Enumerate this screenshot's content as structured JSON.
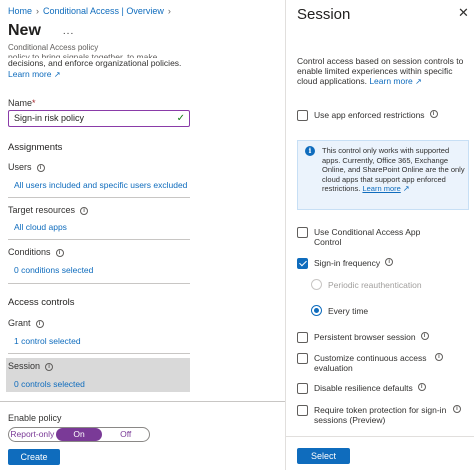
{
  "breadcrumb": {
    "items": [
      "Home",
      "Conditional Access | Overview"
    ]
  },
  "page": {
    "title": "New",
    "more": "...",
    "subtitle": "Conditional Access policy",
    "desc_clipped": "policy to bring signals together, to make",
    "desc_lines": [
      "decisions, and enforce organizational policies."
    ],
    "learn_more": "Learn more"
  },
  "name_field": {
    "label": "Name",
    "required_mark": "*",
    "value": "Sign-in risk policy"
  },
  "assignments": {
    "heading": "Assignments",
    "users": {
      "label": "Users",
      "value": "All users included and specific users excluded"
    },
    "targets": {
      "label": "Target resources",
      "value": "All cloud apps"
    },
    "conditions": {
      "label": "Conditions",
      "value": "0 conditions selected"
    }
  },
  "access_controls": {
    "heading": "Access controls",
    "grant": {
      "label": "Grant",
      "value": "1 control selected"
    },
    "session": {
      "label": "Session",
      "value": "0 controls selected"
    }
  },
  "enable_policy": {
    "label": "Enable policy",
    "options": [
      "Report-only",
      "On",
      "Off"
    ],
    "selected": "On"
  },
  "create_button": "Create",
  "panel": {
    "title": "Session",
    "description": "Control access based on session controls to enable limited experiences within specific cloud applications.",
    "learn_more": "Learn more",
    "app_enforced": {
      "label": "Use app enforced restrictions",
      "checked": false
    },
    "info_text": "This control only works with supported apps. Currently, Office 365, Exchange Online, and SharePoint Online are the only cloud apps that support app enforced restrictions.",
    "info_learn_more": "Learn more",
    "app_control": {
      "label": "Use Conditional Access App Control",
      "checked": false
    },
    "signin_freq": {
      "label": "Sign-in frequency",
      "checked": true
    },
    "periodic": {
      "label": "Periodic reauthentication",
      "selected": false
    },
    "every_time": {
      "label": "Every time",
      "selected": true
    },
    "persistent": {
      "label": "Persistent browser session",
      "checked": false
    },
    "cae": {
      "label": "Customize continuous access evaluation",
      "checked": false
    },
    "resilience": {
      "label": "Disable resilience defaults",
      "checked": false
    },
    "token": {
      "label": "Require token protection for sign-in sessions (Preview)",
      "checked": false
    },
    "select_button": "Select"
  },
  "colors": {
    "accent": "#0f6cbd",
    "toggle_on": "#7a3a97",
    "success": "#107c10"
  }
}
